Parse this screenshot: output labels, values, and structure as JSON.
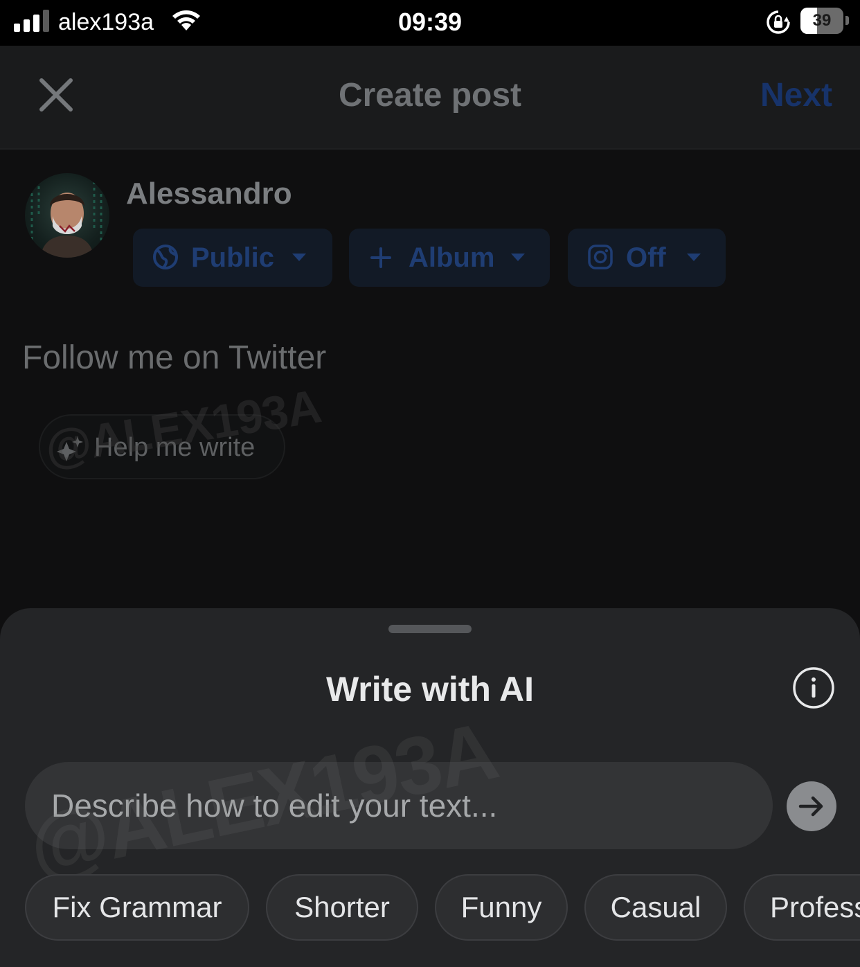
{
  "status_bar": {
    "carrier": "alex193a",
    "time": "09:39",
    "battery_level": "39",
    "battery_fraction": 0.39,
    "signal_bars_active": 3,
    "signal_bars_total": 4
  },
  "header": {
    "title": "Create post",
    "next_label": "Next",
    "close_icon": "close-icon"
  },
  "composer": {
    "author_name": "Alessandro",
    "audience": {
      "label": "Public",
      "icon": "globe-icon"
    },
    "album": {
      "label": "Album",
      "icon": "plus-icon"
    },
    "instagram": {
      "label": "Off",
      "icon": "instagram-icon"
    },
    "post_text": "Follow me on Twitter",
    "help_button_label": "Help me write",
    "watermark": "@ALEX193A"
  },
  "ai_sheet": {
    "title": "Write with AI",
    "input_placeholder": "Describe how to edit your text...",
    "watermark": "@ALEX193A",
    "suggestions": [
      "Fix Grammar",
      "Shorter",
      "Funny",
      "Casual",
      "Profess"
    ]
  },
  "colors": {
    "accent_dimmed": "#17336a",
    "sheet_background": "#242527",
    "pill_background": "#2d2e30"
  }
}
